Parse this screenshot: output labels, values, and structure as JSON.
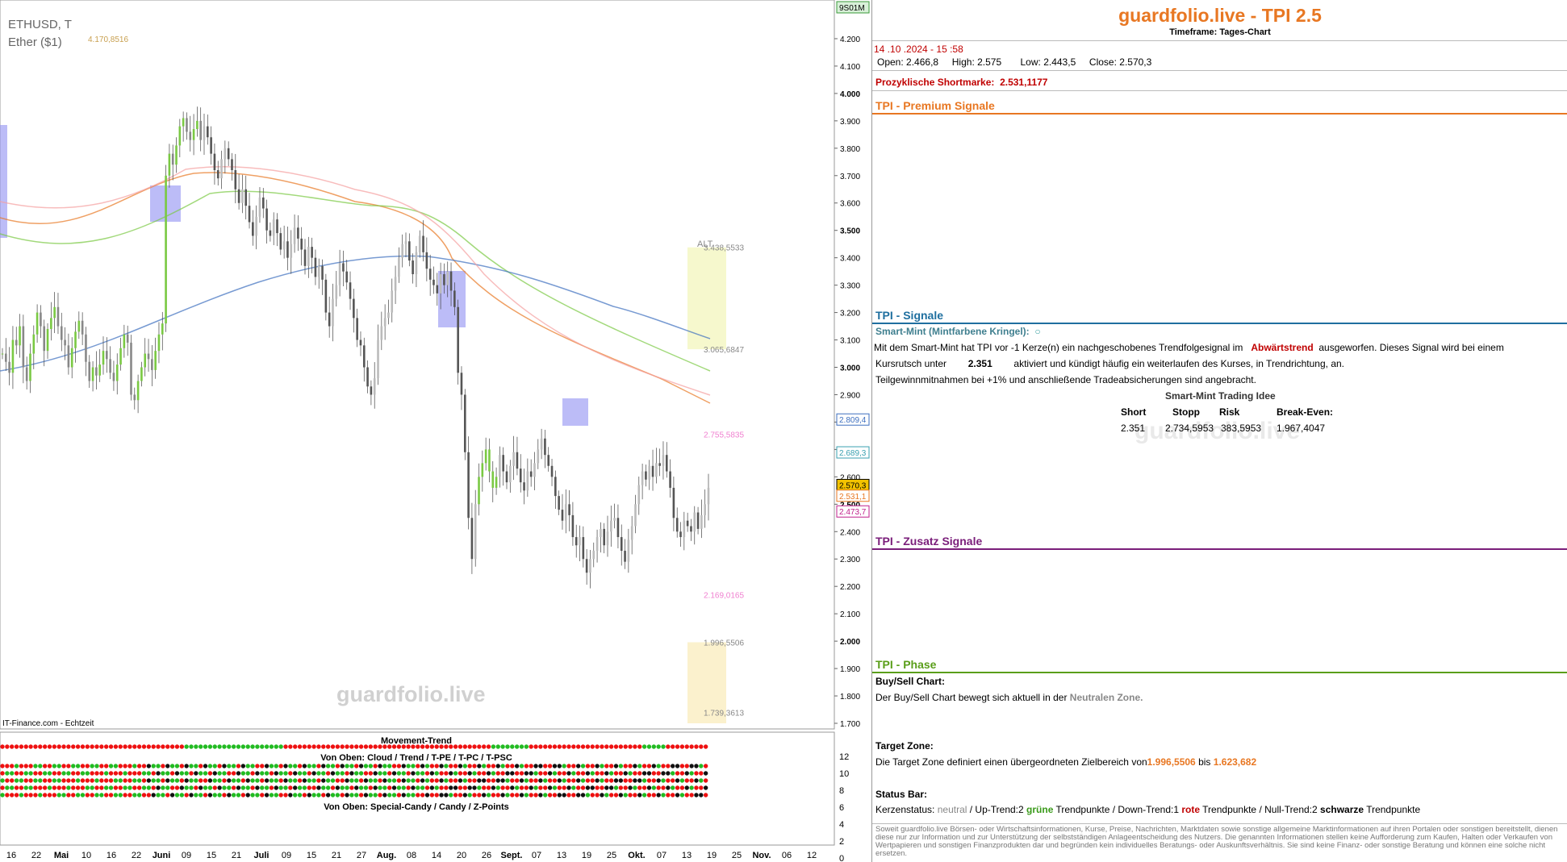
{
  "chart_data": {
    "type": "candlestick",
    "symbol": "ETHUSD, T",
    "instrument": "Ether ($1)",
    "source": "IT-Finance.com - Echtzeit",
    "watermark": "guardfolio.live",
    "badge": "9S01M",
    "ylim": [
      1700,
      4250
    ],
    "y_ticks": [
      "4.200",
      "4.100",
      "4.000",
      "3.900",
      "3.800",
      "3.700",
      "3.600",
      "3.500",
      "3.400",
      "3.300",
      "3.200",
      "3.100",
      "3.000",
      "2.900",
      "2.800",
      "2.700",
      "2.600",
      "2.500",
      "2.400",
      "2.300",
      "2.200",
      "2.100",
      "2.000",
      "1.900",
      "1.800",
      "1.700"
    ],
    "x_ticks": [
      "16",
      "22",
      "Mai",
      "10",
      "16",
      "22",
      "Juni",
      "09",
      "15",
      "21",
      "Juli",
      "09",
      "15",
      "21",
      "27",
      "Aug.",
      "08",
      "14",
      "20",
      "26",
      "Sept.",
      "07",
      "13",
      "19",
      "25",
      "Okt.",
      "07",
      "13",
      "19",
      "25",
      "Nov.",
      "06",
      "12"
    ],
    "bold_x_ticks": [
      "Mai",
      "Juni",
      "Juli",
      "Aug.",
      "Sept.",
      "Okt.",
      "Nov."
    ],
    "closes": [
      3050,
      3020,
      2980,
      3100,
      3080,
      3150,
      3000,
      2950,
      3050,
      3120,
      3200,
      3150,
      3060,
      3140,
      3180,
      3220,
      3150,
      3100,
      3080,
      3000,
      3070,
      3130,
      3170,
      3120,
      3020,
      2950,
      3000,
      2970,
      3010,
      3060,
      3030,
      2980,
      2950,
      3010,
      3070,
      3120,
      3090,
      2900,
      2880,
      2950,
      3000,
      3050,
      3030,
      2990,
      3060,
      3120,
      3160,
      3700,
      3780,
      3740,
      3810,
      3880,
      3910,
      3860,
      3830,
      3870,
      3900,
      3830,
      3880,
      3840,
      3780,
      3720,
      3690,
      3760,
      3800,
      3760,
      3720,
      3650,
      3600,
      3650,
      3590,
      3530,
      3480,
      3550,
      3620,
      3580,
      3500,
      3480,
      3540,
      3490,
      3430,
      3460,
      3400,
      3450,
      3510,
      3470,
      3430,
      3370,
      3440,
      3400,
      3330,
      3370,
      3320,
      3200,
      3150,
      3250,
      3300,
      3380,
      3350,
      3310,
      3250,
      3180,
      3100,
      3080,
      3000,
      2930,
      2900,
      2960,
      3100,
      3150,
      3180,
      3200,
      3280,
      3330,
      3400,
      3450,
      3460,
      3390,
      3340,
      3420,
      3480,
      3420,
      3360,
      3320,
      3300,
      3270,
      3340,
      3300,
      3350,
      3280,
      3220,
      2980,
      2900,
      2690,
      2450,
      2300,
      2500,
      2600,
      2650,
      2700,
      2620,
      2560,
      2600,
      2680,
      2620,
      2580,
      2640,
      2690,
      2630,
      2580,
      2550,
      2620,
      2600,
      2650,
      2700,
      2740,
      2680,
      2640,
      2600,
      2530,
      2480,
      2440,
      2500,
      2460,
      2380,
      2350,
      2380,
      2300,
      2250,
      2300,
      2330,
      2380,
      2410,
      2350,
      2400,
      2440,
      2450,
      2380,
      2330,
      2290,
      2370,
      2420,
      2500,
      2570,
      2620,
      2590,
      2640,
      2600,
      2650,
      2640,
      2680,
      2620,
      2560,
      2450,
      2400,
      2380,
      2440,
      2420,
      2400,
      2470,
      2410,
      2460,
      2500,
      2560
    ],
    "chart_annotations": {
      "high_label": "4.170,8516",
      "zone_label": "ALT",
      "levels": [
        "3.438,5533",
        "3.065,6847",
        "2.755,5835",
        "2.169,0165",
        "1.996,5506",
        "1.739,3613"
      ],
      "price_tags": [
        {
          "text": "2.809,4",
          "color": "#3d6fbf",
          "value": 2809.4
        },
        {
          "text": "2.689,3",
          "color": "#3aa0b0",
          "value": 2689.3
        },
        {
          "text": "2.570,3",
          "color": "#000000",
          "value": 2570.3,
          "bg": "#f2c200"
        },
        {
          "text": "2.531,1",
          "color": "#e87722",
          "value": 2531.1
        },
        {
          "text": "2.473,7",
          "color": "#c0208c",
          "value": 2473.7
        }
      ]
    },
    "movement_trend": {
      "title": "Movement-Trend",
      "subtitle1": "Von Oben: Cloud / Trend / T-PE / T-PC / T-PSC",
      "subtitle2": "Von Oben: Special-Candy / Candy / Z-Points",
      "y_ticks": [
        "12",
        "10",
        "8",
        "6",
        "4",
        "2",
        "0"
      ]
    }
  },
  "panel": {
    "title": "guardfolio.live - TPI 2.5",
    "timeframe": "Timeframe: Tages-Chart",
    "datetime": "14 .10 .2024  - 15 :58",
    "ohlc": {
      "open_label": "Open:",
      "open": "2.466,8",
      "high_label": "High:",
      "high": "2.575",
      "low_label": "Low:",
      "low": "2.443,5",
      "close_label": "Close:",
      "close": "2.570,3"
    },
    "shortmark_label": "Prozyklische Shortmarke:",
    "shortmark_value": "2.531,1177",
    "premium_title": "TPI - Premium Signale",
    "signals_title": "TPI - Signale",
    "smart_mint_label": "Smart-Mint (Mintfarbene Kringel):",
    "sm_line1_a": "Mit dem Smart-Mint hat TPI vor -1  Kerze(n) ein nachgeschobenes Trendfolgesignal im",
    "sm_line1_trend": "Abwärtstrend",
    "sm_line1_b": "ausgeworfen. Dieses Signal wird bei einem",
    "sm_line2_a": "Kursrutsch unter",
    "sm_line2_value": "2.351",
    "sm_line2_b": "aktiviert und kündigt häufig ein weiterlaufen des Kurses, in Trendrichtung, an.",
    "sm_line3": "Teilgewinnmitnahmen bei +1% und anschließende Tradeabsicherungen sind angebracht.",
    "trade_idea_title": "Smart-Mint Trading Idee",
    "trade_headers": [
      "Short",
      "Stopp",
      "Risk",
      "Break-Even:"
    ],
    "trade_values": [
      "2.351",
      "2.734,5953",
      "383,5953",
      "1.967,4047"
    ],
    "watermark": "guardfolio.live",
    "zusatz_title": "TPI - Zusatz Signale",
    "phase_title": "TPI - Phase",
    "buysell_label": "Buy/Sell Chart:",
    "buysell_text": "Der Buy/Sell Chart bewegt sich aktuell in der",
    "buysell_zone": "Neutralen Zone.",
    "target_label": "Target Zone:",
    "target_text": "Die Target Zone definiert einen übergeordneten Zielbereich von",
    "target_from": "1.996,5506",
    "target_bis": "bis",
    "target_to": "1.623,682",
    "status_label": "Status Bar:",
    "status_a": "Kerzenstatus:",
    "status_neutral": "neutral",
    "status_b": "/ Up-Trend:2",
    "status_gruene": "grüne",
    "status_c": "Trendpunkte  / Down-Trend:1",
    "status_rote": "rote",
    "status_d": "Trendpunkte / Null-Trend:2",
    "status_schwarze": "schwarze",
    "status_e": "Trendpunkte",
    "disclaimer": "Soweit guardfolio.live Börsen- oder Wirtschaftsinformationen, Kurse, Preise, Nachrichten, Marktdaten sowie sonstige allgemeine Marktinformationen auf ihren Portalen oder sonstigen bereitstellt, dienen diese nur zur Information und zur Unterstützung der selbstständigen Anlageentscheidung des Nutzers. Die genannten Informationen stellen keine Aufforderung zum Kaufen, Halten oder Verkaufen von Wertpapieren und sonstigen Finanzprodukten dar und begründen kein individuelles Beratungs- oder Auskunftsverhältnis. Sie sind keine Finanz- oder sonstige Beratung und können eine solche nicht ersetzen."
  },
  "colors": {
    "brand": "#e87722",
    "premium": "#e87722",
    "signals": "#1f6f9f",
    "zusatz": "#7a1e7a",
    "phase": "#5a9e1a",
    "up": "#7ac943",
    "down": "#c00000"
  }
}
